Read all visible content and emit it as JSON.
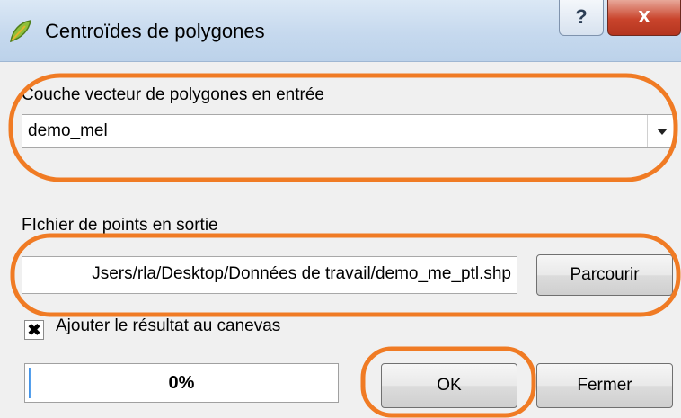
{
  "window": {
    "title": "Centroïdes de polygones",
    "help_label": "?",
    "close_label": "x"
  },
  "input_layer": {
    "label": "Couche vecteur de polygones en entrée",
    "value": "demo_mel"
  },
  "output_file": {
    "label": "FIchier de points en sortie",
    "value": "Jsers/rla/Desktop/Données de travail/demo_me_ptl.shp",
    "browse_label": "Parcourir"
  },
  "add_to_canvas": {
    "checked": true,
    "check_mark": "✖",
    "label": "Ajouter le résultat au canevas"
  },
  "progress": {
    "value": 0,
    "text": "0%"
  },
  "buttons": {
    "ok": "OK",
    "close": "Fermer"
  },
  "annotation_color": "#f07b24"
}
